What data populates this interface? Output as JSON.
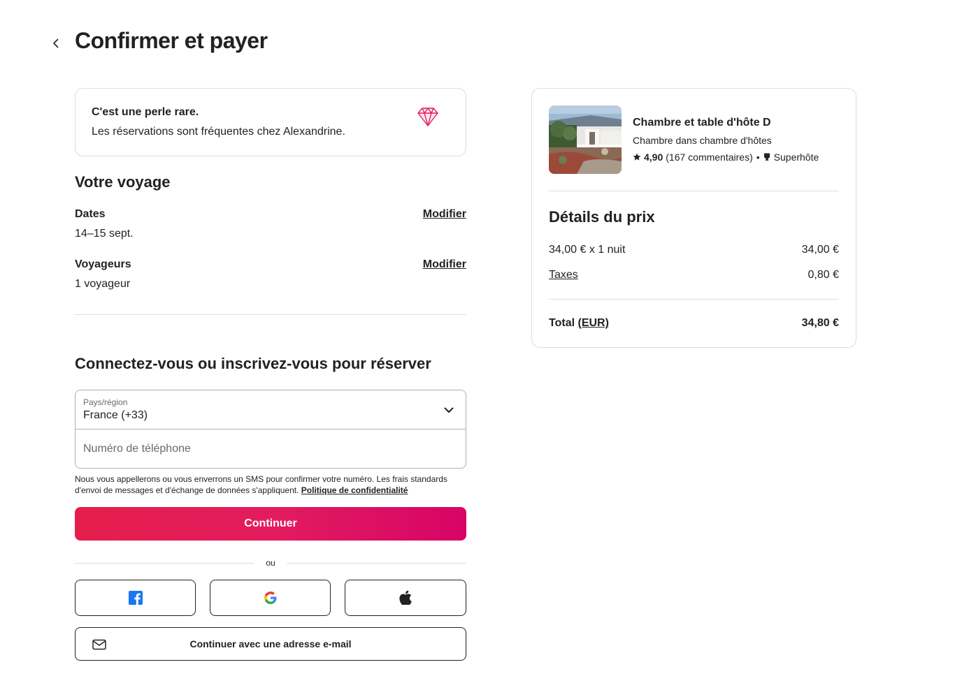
{
  "page": {
    "title": "Confirmer et payer"
  },
  "rare_find": {
    "title": "C'est une perle rare.",
    "text": "Les réservations sont fréquentes chez Alexandrine.",
    "icon": "diamond-icon"
  },
  "trip": {
    "section_title": "Votre voyage",
    "dates_label": "Dates",
    "dates_value": "14–15 sept.",
    "guests_label": "Voyageurs",
    "guests_value": "1 voyageur",
    "modify_label": "Modifier"
  },
  "login": {
    "section_title": "Connectez-vous ou inscrivez-vous pour réserver",
    "country_label": "Pays/région",
    "country_value": "France (+33)",
    "phone_placeholder": "Numéro de téléphone",
    "sms_note": "Nous vous appellerons ou vous enverrons un SMS pour confirmer votre numéro. Les frais standards d'envoi de messages et d'échange de données s'appliquent.",
    "privacy_link": "Politique de confidentialité",
    "continue_label": "Continuer",
    "or_label": "ou",
    "email_button_label": "Continuer avec une adresse e-mail"
  },
  "listing": {
    "title": "Chambre et table d'hôte D",
    "subtitle": "Chambre dans chambre d'hôtes",
    "rating": "4,90",
    "reviews": "(167 commentaires)",
    "separator": "•",
    "superhost": "Superhôte"
  },
  "price": {
    "section_title": "Détails du prix",
    "nightly_label": "34,00 € x 1 nuit",
    "nightly_value": "34,00 €",
    "taxes_label": "Taxes",
    "taxes_value": "0,80 €",
    "total_label": "Total",
    "total_currency": "(EUR)",
    "total_value": "34,80 €"
  },
  "colors": {
    "brand_start": "#e61e4d",
    "brand_end": "#d70466",
    "diamond": "#e31c5f",
    "facebook": "#1877f2"
  }
}
